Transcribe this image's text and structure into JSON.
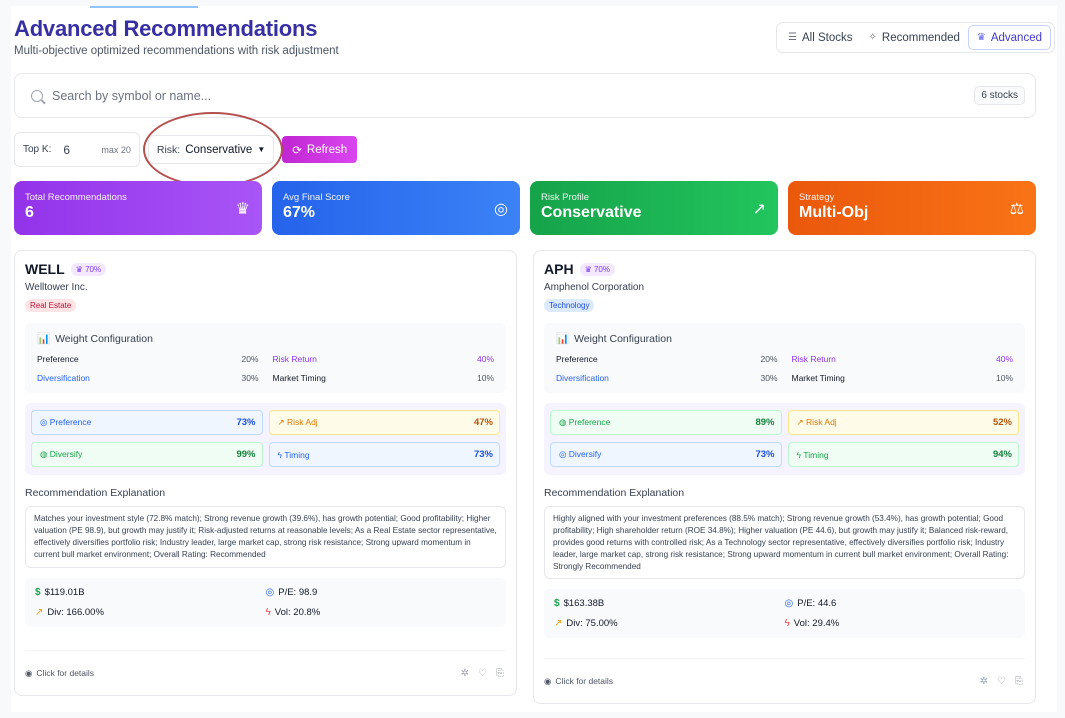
{
  "header": {
    "title": "Advanced Recommendations",
    "subtitle": "Multi-objective optimized recommendations with risk adjustment"
  },
  "view_switch": {
    "all_stocks": "All Stocks",
    "recommended": "Recommended",
    "advanced": "Advanced",
    "active": "Advanced"
  },
  "search": {
    "placeholder": "Search by symbol or name...",
    "count": "6 stocks"
  },
  "controls": {
    "topk_label": "Top K:",
    "topk_value": "6",
    "topk_max": "max 20",
    "risk_label": "Risk:",
    "risk_value": "Conservative",
    "refresh_label": "Refresh"
  },
  "stats": [
    {
      "label": "Total Recommendations",
      "value": "6",
      "icon": "crown-icon"
    },
    {
      "label": "Avg Final Score",
      "value": "67%",
      "icon": "target-icon"
    },
    {
      "label": "Risk Profile",
      "value": "Conservative",
      "icon": "trend-up-icon"
    },
    {
      "label": "Strategy",
      "value": "Multi-Obj",
      "icon": "scale-icon"
    }
  ],
  "weights_title": "Weight Configuration",
  "explanation_title": "Recommendation Explanation",
  "click_details": "Click for details",
  "cards": [
    {
      "symbol": "WELL",
      "score": "70%",
      "company": "Welltower Inc.",
      "sector": "Real Estate",
      "weights": {
        "preference_label": "Preference",
        "preference": "20%",
        "risk_return_label": "Risk Return",
        "risk_return": "40%",
        "diversification_label": "Diversification",
        "diversification": "30%",
        "market_timing_label": "Market Timing",
        "market_timing": "10%"
      },
      "scores": {
        "preference_label": "Preference",
        "preference": "73%",
        "risk_adj_label": "Risk Adj",
        "risk_adj": "47%",
        "diversify_label": "Diversify",
        "diversify": "99%",
        "timing_label": "Timing",
        "timing": "73%"
      },
      "explanation": "Matches your investment style (72.8% match); Strong revenue growth (39.6%), has growth potential; Good profitability; Higher valuation (PE 98.9), but growth may justify it; Risk-adjusted returns at reasonable levels; As a Real Estate sector representative, effectively diversifies portfolio risk; Industry leader, large market cap, strong risk resistance; Strong upward momentum in current bull market environment; Overall Rating: Recommended",
      "metrics": {
        "market_cap": "$119.01B",
        "pe": "P/E: 98.9",
        "div": "Div: 166.00%",
        "vol": "Vol: 20.8%"
      }
    },
    {
      "symbol": "APH",
      "score": "70%",
      "company": "Amphenol Corporation",
      "sector": "Technology",
      "weights": {
        "preference_label": "Preference",
        "preference": "20%",
        "risk_return_label": "Risk Return",
        "risk_return": "40%",
        "diversification_label": "Diversification",
        "diversification": "30%",
        "market_timing_label": "Market Timing",
        "market_timing": "10%"
      },
      "scores": {
        "preference_label": "Preference",
        "preference": "89%",
        "risk_adj_label": "Risk Adj",
        "risk_adj": "52%",
        "diversify_label": "Diversify",
        "diversify": "73%",
        "timing_label": "Timing",
        "timing": "94%"
      },
      "explanation": "Highly aligned with your investment preferences (88.5% match); Strong revenue growth (53.4%), has growth potential; Good profitability; High shareholder return (ROE 34.8%); Higher valuation (PE 44.6), but growth may justify it; Balanced risk-reward, provides good returns with controlled risk; As a Technology sector representative, effectively diversifies portfolio risk; Industry leader, large market cap, strong risk resistance; Strong upward momentum in current bull market environment; Overall Rating: Strongly Recommended",
      "metrics": {
        "market_cap": "$163.38B",
        "pe": "P/E: 44.6",
        "div": "Div: 75.00%",
        "vol": "Vol: 29.4%"
      }
    }
  ],
  "colors": {
    "title": "#3730a3",
    "refresh": "#c026d3",
    "stat_purple": "#a855f7",
    "stat_blue": "#3b82f6",
    "stat_green": "#22c55e",
    "stat_orange": "#f97316",
    "annotation": "#b55050"
  }
}
